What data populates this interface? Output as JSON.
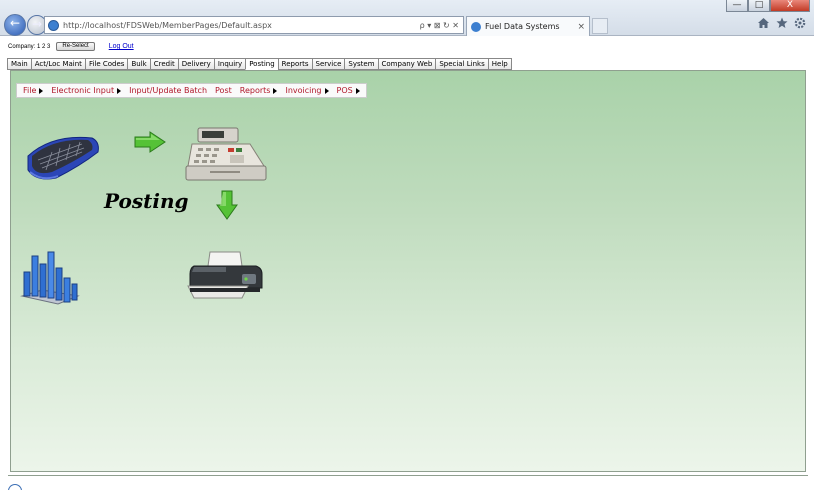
{
  "browser": {
    "address": "http://localhost/FDSWeb/MemberPages/Default.aspx",
    "address_tools": "ρ ▾ ⊠ ↻ ✕",
    "tab_title": "Fuel Data Systems",
    "tab_close": "×",
    "window_buttons": [
      "—",
      "□",
      "X"
    ],
    "nav_back": "←",
    "nav_forward": "→",
    "toolbar_icons": [
      "home-icon",
      "star-icon",
      "gear-icon"
    ]
  },
  "header": {
    "company_label": "Company: 1 2 3",
    "reselect_button": "Re-Select",
    "logout_link": "Log Out"
  },
  "menu_tabs": [
    {
      "label": "Main",
      "active": false
    },
    {
      "label": "Act/Loc Maint",
      "active": false
    },
    {
      "label": "File Codes",
      "active": false
    },
    {
      "label": "Bulk",
      "active": false
    },
    {
      "label": "Credit",
      "active": false
    },
    {
      "label": "Delivery",
      "active": false
    },
    {
      "label": "Inquiry",
      "active": false
    },
    {
      "label": "Posting",
      "active": true
    },
    {
      "label": "Reports",
      "active": false
    },
    {
      "label": "Service",
      "active": false
    },
    {
      "label": "System",
      "active": false
    },
    {
      "label": "Company Web",
      "active": false
    },
    {
      "label": "Special Links",
      "active": false
    },
    {
      "label": "Help",
      "active": false
    }
  ],
  "submenu": [
    {
      "label": "File",
      "has_children": true
    },
    {
      "label": "Electronic Input",
      "has_children": true
    },
    {
      "label": "Input/Update Batch",
      "has_children": false
    },
    {
      "label": "Post",
      "has_children": false
    },
    {
      "label": "Reports",
      "has_children": true
    },
    {
      "label": "Invoicing",
      "has_children": true
    },
    {
      "label": "POS",
      "has_children": true
    }
  ],
  "main": {
    "title": "Posting"
  },
  "colors": {
    "panel_top": "#a9d2a9",
    "panel_bottom": "#ecf5ea",
    "submenu_text": "#b0182a",
    "link": "#0000cc"
  }
}
